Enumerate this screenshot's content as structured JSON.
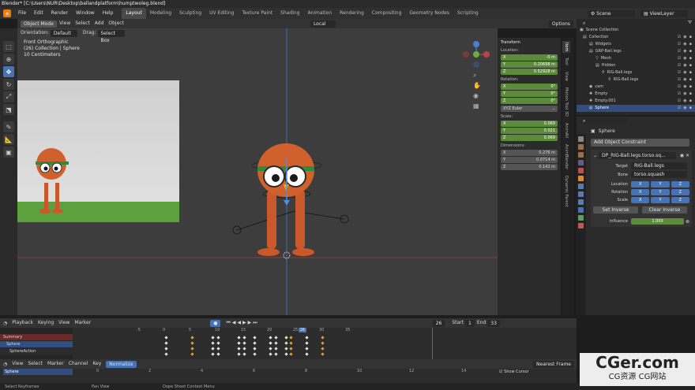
{
  "window": {
    "title": "Blender* [C:\\Users\\NUR\\Desktop\\ballandplatform\\humptwoleg.blend]"
  },
  "menu": [
    "File",
    "Edit",
    "Render",
    "Window",
    "Help"
  ],
  "workspaces": [
    "Layout",
    "Modeling",
    "Sculpting",
    "UV Editing",
    "Texture Paint",
    "Shading",
    "Animation",
    "Rendering",
    "Compositing",
    "Geometry Nodes",
    "Scripting"
  ],
  "active_workspace": "Layout",
  "scene": {
    "label": "Scene",
    "view_layer": "ViewLayer"
  },
  "viewport_header": {
    "mode": "Object Mode",
    "items": [
      "View",
      "Select",
      "Add",
      "Object"
    ],
    "transform": "Local",
    "options": "Options"
  },
  "viewport_subheader": {
    "orientation_label": "Orientation:",
    "orientation": "Default",
    "drag_label": "Drag:",
    "drag": "Select Box"
  },
  "viewport_info": [
    "Front Orthographic",
    "(26) Collection | Sphere",
    "10 Centimeters"
  ],
  "npanel": {
    "section": "Transform",
    "location_label": "Location:",
    "location": [
      [
        "X",
        "-0 m"
      ],
      [
        "Y",
        "0.20698 m"
      ],
      [
        "Z",
        "0.52928 m"
      ]
    ],
    "rotation_label": "Rotation:",
    "rotation": [
      [
        "X",
        "0°"
      ],
      [
        "Y",
        "0°"
      ],
      [
        "Z",
        "0°"
      ]
    ],
    "rotation_mode": "XYZ Euler",
    "scale_label": "Scale:",
    "scale": [
      [
        "X",
        "0.069"
      ],
      [
        "Y",
        "0.021"
      ],
      [
        "Z",
        "0.069"
      ]
    ],
    "dimensions_label": "Dimensions:",
    "dimensions": [
      [
        "X",
        "0.276 m"
      ],
      [
        "Y",
        "0.0714 m"
      ],
      [
        "Z",
        "0.142 m"
      ]
    ],
    "tabs": [
      "Item",
      "Tool",
      "View",
      "Motion Tool 3D",
      "AnimAll",
      "AnimBlender",
      "Dynamic Parent"
    ]
  },
  "outliner": {
    "items": [
      "Scene Collection",
      "Collection",
      "Widgets",
      "GRP-Ball.legs",
      "Mesh",
      "Hidden",
      "RIG-Ball.legs",
      "RIG-Ball.legs",
      "cam",
      "Empty",
      "Empty.001",
      "Sphere"
    ],
    "selected": "Sphere"
  },
  "properties": {
    "object": "Sphere",
    "add_constraint": "Add Object Constraint",
    "constraint_name": "DP_RIG-Ball.legs.torso.sq...",
    "target_label": "Target",
    "target": "RIG-Ball.legs",
    "bone_label": "Bone",
    "bone": "torso.squash",
    "location_label": "Location",
    "rotation_label": "Rotation",
    "scale_label": "Scale",
    "axes": [
      "X",
      "Y",
      "Z"
    ],
    "set_inverse": "Set Inverse",
    "clear_inverse": "Clear Inverse",
    "influence_label": "Influence",
    "influence": "1.000"
  },
  "timeline": {
    "menu": [
      "Playback",
      "Keying",
      "View",
      "Marker"
    ],
    "current_frame": "26",
    "start_label": "Start",
    "start": "1",
    "end_label": "End",
    "end": "33",
    "ruler": [
      "-5",
      "0",
      "5",
      "10",
      "15",
      "20",
      "25",
      "26",
      "30",
      "35"
    ],
    "channels": [
      "Summary",
      "Sphere",
      "SphereAction"
    ]
  },
  "dopesheet": {
    "menu": [
      "View",
      "Select",
      "Marker",
      "Channel",
      "Key"
    ],
    "normalize": "Normalize",
    "snap": "Nearest Frame",
    "show_cursor": "Show Cursor",
    "ruler": [
      "0",
      "2",
      "4",
      "6",
      "8",
      "10",
      "12",
      "14"
    ],
    "channel": "Sphere"
  },
  "status": [
    "Select Keyframes",
    "Pan View",
    "Dope Sheet Context Menu"
  ],
  "watermark": {
    "title": "CGer.com",
    "subtitle": "CG资源 CG网站"
  },
  "colors": {
    "accent": "#4772b3",
    "green_field": "#5a8a3a",
    "body": "#d0612c",
    "floor": "#5da03e"
  }
}
